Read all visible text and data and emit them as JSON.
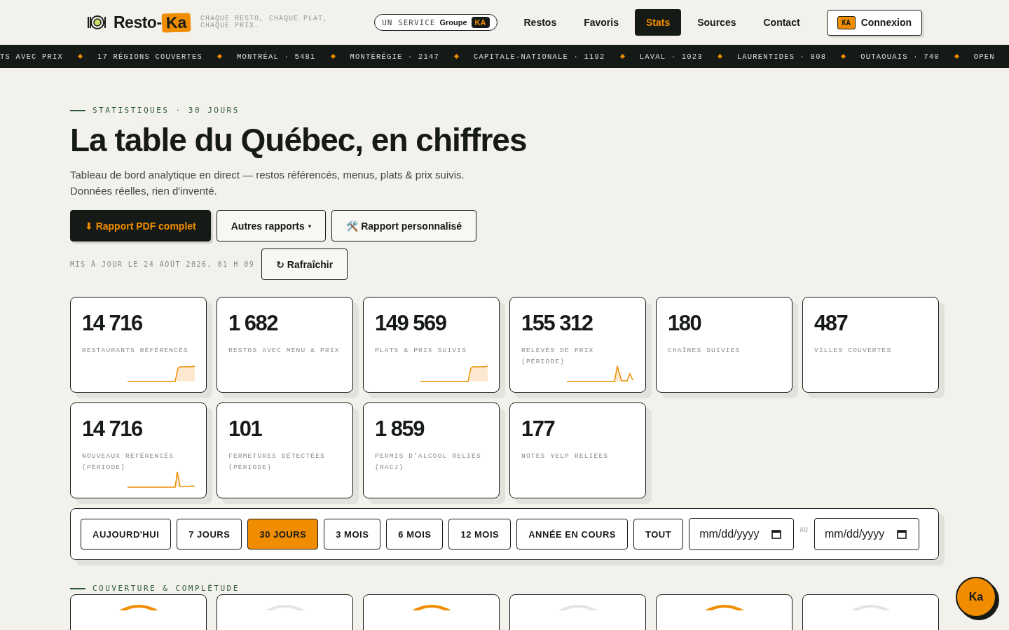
{
  "header": {
    "logo_text": "Resto-",
    "logo_badge": "Ka",
    "tagline": "CHAQUE RESTO, CHAQUE PLAT, CHAQUE PRIX.",
    "service": {
      "prefix": "UN SERVICE",
      "name": "Groupe",
      "badge": "KA"
    },
    "nav": [
      {
        "label": "Restos",
        "selected": false
      },
      {
        "label": "Favoris",
        "selected": false
      },
      {
        "label": "Stats",
        "selected": true
      },
      {
        "label": "Sources",
        "selected": false
      },
      {
        "label": "Contact",
        "selected": false
      }
    ],
    "login": {
      "badge": "KA",
      "label": "Connexion"
    }
  },
  "ticker": [
    "TS AVEC PRIX",
    "17 RÉGIONS COUVERTES",
    "MONTRÉAL · 5481",
    "MONTÉRÉGIE · 2147",
    "CAPITALE-NATIONALE · 1192",
    "LAVAL · 1023",
    "LAURENTIDES · 808",
    "OUTAOUAIS · 740",
    "OPEN"
  ],
  "hero": {
    "eyebrow": "STATISTIQUES · 30 JOURS",
    "title": "La table du Québec, en chiffres",
    "description": "Tableau de bord analytique en direct — restos référencés, menus, plats & prix suivis. Données réelles, rien d'inventé.",
    "actions": [
      {
        "kind": "primary",
        "icon": "⬇",
        "label": "Rapport PDF complet"
      },
      {
        "kind": "dropdown",
        "icon": "▾",
        "label": "Autres rapports"
      },
      {
        "kind": "secondary",
        "icon": "🛠️",
        "label": "Rapport personnalisé"
      }
    ],
    "updated": "MIS À JOUR LE 24 AOÛT 2026, 01 H 09",
    "refresh": {
      "icon": "↻",
      "label": "Rafraîchir"
    }
  },
  "stats": [
    {
      "value": "14 716",
      "label": "RESTAURANTS RÉFÉRENCÉS",
      "kind": "step"
    },
    {
      "value": "1 682",
      "label": "RESTOS AVEC MENU & PRIX",
      "kind": "plain"
    },
    {
      "value": "149 569",
      "label": "PLATS & PRIX SUIVIS",
      "kind": "step"
    },
    {
      "value": "155 312",
      "label": "RELEVÉS DE PRIX (PÉRIODE)",
      "kind": "spikes"
    },
    {
      "value": "180",
      "label": "CHAÎNES SUIVIES",
      "kind": "plain"
    },
    {
      "value": "487",
      "label": "VILLES COUVERTES",
      "kind": "plain"
    },
    {
      "value": "14 716",
      "label": "NOUVEAUX RÉFÉRENCÉS (PÉRIODE)",
      "kind": "spike"
    },
    {
      "value": "101",
      "label": "FERMETURES DÉTECTÉES (PÉRIODE)",
      "kind": "plain"
    },
    {
      "value": "1 859",
      "label": "PERMIS D'ALCOOL RELIÉS (RACJ)",
      "kind": "plain"
    },
    {
      "value": "177",
      "label": "NOTES YELP RELIÉES",
      "kind": "plain"
    }
  ],
  "periods": [
    {
      "label": "AUJOURD'HUI",
      "selected": false
    },
    {
      "label": "7 JOURS",
      "selected": false
    },
    {
      "label": "30 JOURS",
      "selected": true
    },
    {
      "label": "3 MOIS",
      "selected": false
    },
    {
      "label": "6 MOIS",
      "selected": false
    },
    {
      "label": "12 MOIS",
      "selected": false
    },
    {
      "label": "ANNÉE EN COURS",
      "selected": false
    },
    {
      "label": "TOUT",
      "selected": false
    }
  ],
  "date_range": {
    "from_placeholder": "mm/dd/yyyy",
    "separator": "AU",
    "to_placeholder": "mm/dd/yyyy"
  },
  "coverage": {
    "eyebrow": "COUVERTURE & COMPLÉTUDE",
    "cards": [
      {
        "accent": true
      },
      {
        "accent": false
      },
      {
        "accent": true
      },
      {
        "accent": false
      },
      {
        "accent": true
      },
      {
        "accent": false
      }
    ]
  },
  "fab": {
    "label": "Ka"
  }
}
